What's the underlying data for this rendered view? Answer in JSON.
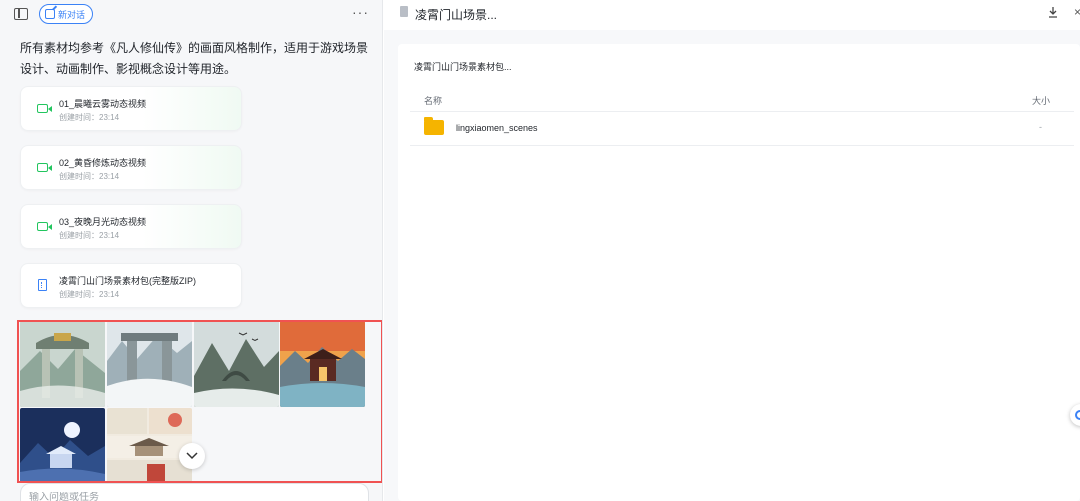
{
  "header": {
    "new_chat_label": "新对话",
    "more_label": "···"
  },
  "chat": {
    "description": "所有素材均参考《凡人修仙传》的画面风格制作，适用于游戏场景设计、动画制作、影视概念设计等用途。",
    "files": [
      {
        "name": "01_晨曦云雾动态视频",
        "time": "创建时间：23:14",
        "icon": "video-icon"
      },
      {
        "name": "02_黄昏修炼动态视频",
        "time": "创建时间：23:14",
        "icon": "video-icon"
      },
      {
        "name": "03_夜晚月光动态视频",
        "time": "创建时间：23:14",
        "icon": "video-icon"
      },
      {
        "name": "凌霄门山门场景素材包(完整版ZIP)",
        "time": "创建时间：23:14",
        "icon": "zip-file-icon"
      }
    ],
    "gallery": [
      {
        "name": "stone-gate-mist-thumbnail"
      },
      {
        "name": "carved-dragon-gate-thumbnail"
      },
      {
        "name": "mountain-arch-cranes-thumbnail"
      },
      {
        "name": "sunset-temple-thumbnail"
      },
      {
        "name": "moonlit-pavilion-thumbnail"
      },
      {
        "name": "scene-collage-thumbnail"
      }
    ],
    "input_placeholder": "输入问题或任务"
  },
  "viewer": {
    "tab_title": "凌霄门山场景...",
    "package_title": "凌霄门山门场景素材包...",
    "columns": {
      "name": "名称",
      "size": "大小"
    },
    "rows": [
      {
        "name": "lingxiaomen_scenes",
        "size": "-",
        "icon": "folder-icon"
      }
    ]
  },
  "colors": {
    "accent": "#3b82f6",
    "video": "#22c55e",
    "folder": "#f5b400",
    "highlight_border": "#f05252"
  }
}
